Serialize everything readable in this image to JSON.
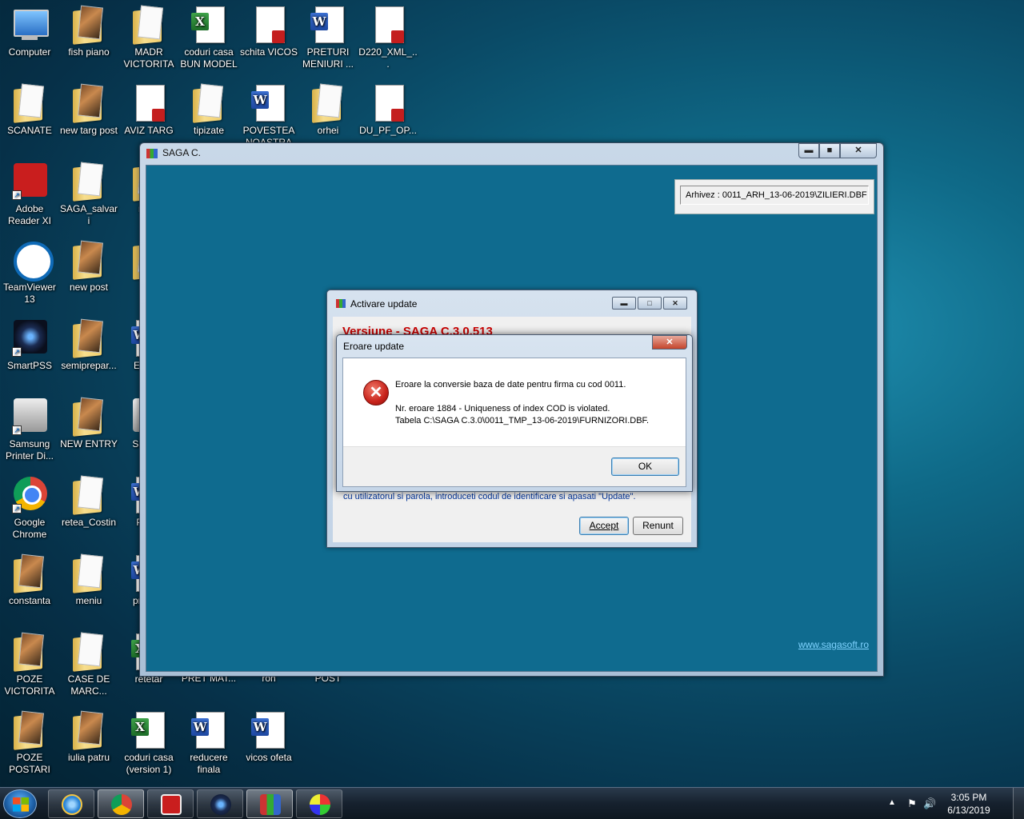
{
  "desktop": {
    "icons": [
      {
        "label": "Computer"
      },
      {
        "label": "fish piano"
      },
      {
        "label": "MADR VICTORITA"
      },
      {
        "label": "coduri casa BUN MODEL"
      },
      {
        "label": "schita VICOS"
      },
      {
        "label": "PRETURI MENIURI ..."
      },
      {
        "label": "D220_XML_..."
      },
      {
        "label": "SCANATE"
      },
      {
        "label": "new targ post"
      },
      {
        "label": "AVIZ TARG"
      },
      {
        "label": "tipizate"
      },
      {
        "label": "POVESTEA NOASTRA"
      },
      {
        "label": "orhei"
      },
      {
        "label": "DU_PF_OP..."
      },
      {
        "label": "Adobe Reader XI"
      },
      {
        "label": "SAGA_salvari"
      },
      {
        "label": "m ca"
      },
      {
        "label": "TeamViewer 13"
      },
      {
        "label": "new post"
      },
      {
        "label": "m"
      },
      {
        "label": "SmartPSS"
      },
      {
        "label": "semiprepar..."
      },
      {
        "label": "Et auto"
      },
      {
        "label": "Samsung Printer Di..."
      },
      {
        "label": "NEW ENTRY"
      },
      {
        "label": "Sa M20"
      },
      {
        "label": "Google Chrome"
      },
      {
        "label": "retea_Costin"
      },
      {
        "label": "Pl CU"
      },
      {
        "label": "constanta"
      },
      {
        "label": "meniu"
      },
      {
        "label": "pro lucr"
      },
      {
        "label": "POZE VICTORITA"
      },
      {
        "label": "CASE DE MARC..."
      },
      {
        "label": "retetar"
      },
      {
        "label": "CALCULATIE PRET MAT..."
      },
      {
        "label": "reducerea 50 ron"
      },
      {
        "label": "FISE DE POST"
      },
      {
        "label": "POZE POSTARI"
      },
      {
        "label": "iulia patru"
      },
      {
        "label": "coduri casa (version 1)"
      },
      {
        "label": "reducere finala"
      },
      {
        "label": "vicos ofeta"
      }
    ]
  },
  "saga_window": {
    "title": "SAGA C.",
    "archive_label": "Arhivez : 0011_ARH_13-06-2019\\ZILIERI.DBF",
    "website_link": "www.sagasoft.ro",
    "min_glyph": "▬",
    "max_glyph": "■",
    "close_glyph": "✕"
  },
  "activare_dialog": {
    "title": "Activare update",
    "heading": "Versiune - SAGA C.3.0.513",
    "hint": "cu utilizatorul si parola, introduceti codul de identificare si apasati \"Update\".",
    "accept_label": "Accept",
    "renunt_label": "Renunt",
    "min_glyph": "▬",
    "max_glyph": "□",
    "close_glyph": "✕"
  },
  "error_dialog": {
    "title": "Eroare update",
    "line1": "Eroare la conversie baza de date pentru firma cu cod 0011.",
    "line2": "Nr. eroare 1884 - Uniqueness of index COD is violated.",
    "line3": "Tabela C:\\SAGA C.3.0\\0011_TMP_13-06-2019\\FURNIZORI.DBF.",
    "ok_label": "OK",
    "close_glyph": "✕",
    "icon_glyph": "✕"
  },
  "taskbar": {
    "time": "3:05 PM",
    "date": "6/13/2019",
    "tray_arrow": "▲",
    "flag_glyph": "⚑",
    "volume_glyph": "🔊"
  }
}
